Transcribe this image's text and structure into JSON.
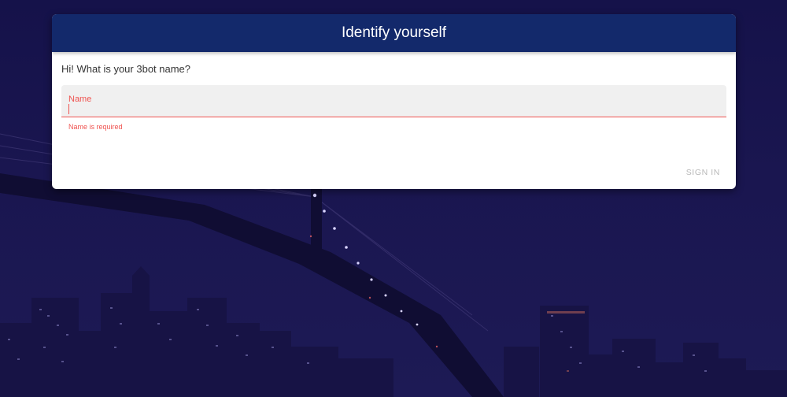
{
  "dialog": {
    "title": "Identify yourself",
    "prompt": "Hi! What is your 3bot name?",
    "name_field": {
      "label": "Name",
      "value": "",
      "error": "Name is required"
    },
    "sign_in_label": "SIGN IN"
  },
  "colors": {
    "header_bg": "#13296b",
    "error": "#ef5350",
    "disabled_text": "#b8b8b8",
    "background": "#1a1650"
  }
}
